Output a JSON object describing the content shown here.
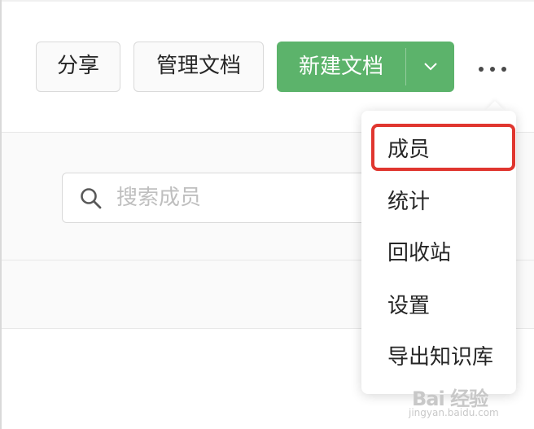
{
  "toolbar": {
    "share_label": "分享",
    "manage_label": "管理文档",
    "new_doc_label": "新建文档"
  },
  "search": {
    "placeholder": "搜索成员"
  },
  "more_menu": {
    "items": [
      {
        "label": "成员",
        "highlighted": true
      },
      {
        "label": "统计"
      },
      {
        "label": "回收站"
      },
      {
        "label": "设置"
      },
      {
        "label": "导出知识库"
      }
    ]
  },
  "watermark": {
    "brand": "Bai 经验",
    "url": "jingyan.baidu.com"
  },
  "colors": {
    "primary_green": "#5cb36b",
    "highlight_red": "#e0362f"
  }
}
